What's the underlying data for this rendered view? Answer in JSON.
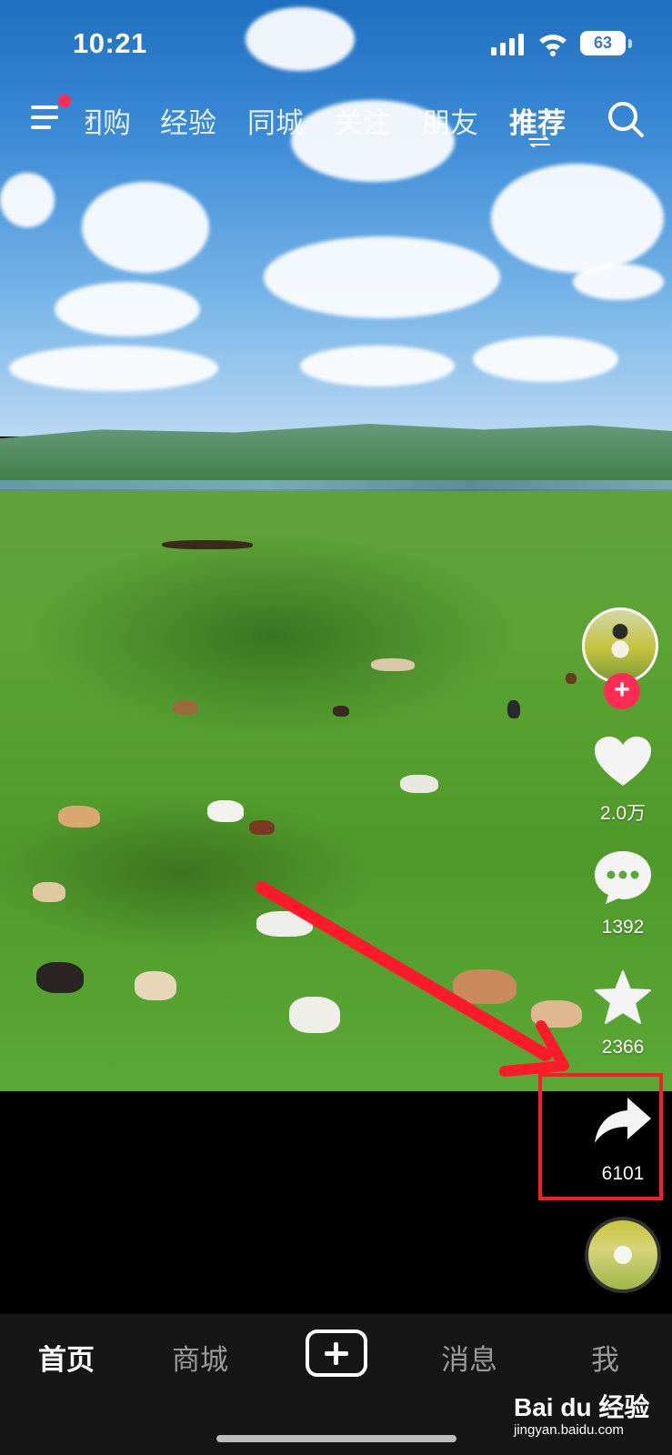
{
  "status_bar": {
    "time": "10:21",
    "battery": "63"
  },
  "top_tabs": [
    {
      "label": "团购"
    },
    {
      "label": "经验"
    },
    {
      "label": "同城"
    },
    {
      "label": "关注"
    },
    {
      "label": "朋友"
    },
    {
      "label": "推荐"
    }
  ],
  "actions": {
    "like_count": "2.0万",
    "comment_count": "1392",
    "favorite_count": "2366",
    "share_count": "6101"
  },
  "bottom_nav": {
    "home": "首页",
    "mall": "商城",
    "messages": "消息",
    "me": "我"
  },
  "watermark": {
    "logo": "Bai du 经验",
    "url": "jingyan.baidu.com"
  },
  "colors": {
    "accent": "#fe2c55",
    "annotation": "#ff1a2a"
  },
  "icons": [
    "menu-icon",
    "search-icon",
    "heart-icon",
    "comment-icon",
    "star-icon",
    "share-icon",
    "plus-icon"
  ]
}
